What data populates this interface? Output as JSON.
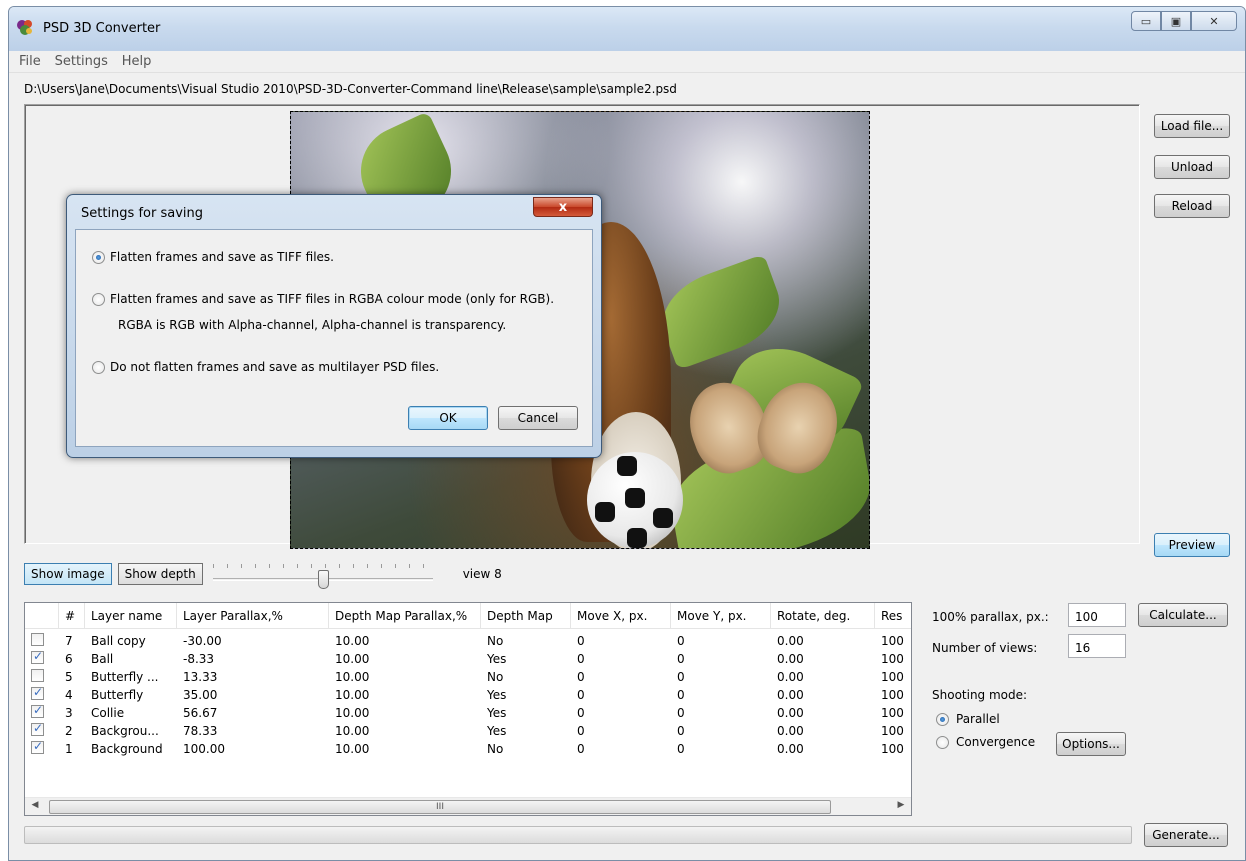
{
  "window": {
    "title": "PSD 3D Converter",
    "minimize_glyph": "▭",
    "maximize_glyph": "▣",
    "close_glyph": "✕"
  },
  "menu": [
    "File",
    "Settings",
    "Help"
  ],
  "file_path": "D:\\Users\\Jane\\Documents\\Visual Studio 2010\\PSD-3D-Converter-Command line\\Release\\sample\\sample2.psd",
  "side_buttons": {
    "load": "Load file...",
    "unload": "Unload",
    "reload": "Reload",
    "preview": "Preview"
  },
  "view_toggle": {
    "show_image": "Show image",
    "show_depth": "Show depth",
    "view_label": "view 8",
    "slider_value": 8,
    "slider_max": 16,
    "active": "Show image"
  },
  "table": {
    "columns": [
      "",
      "#",
      "Layer name",
      "Layer Parallax,%",
      "Depth Map Parallax,%",
      "Depth Map",
      "Move X, px.",
      "Move Y, px.",
      "Rotate, deg.",
      "Res"
    ],
    "rows": [
      {
        "checked": false,
        "num": "7",
        "name": "Ball copy",
        "parallax": "-30.00",
        "dm_parallax": "10.00",
        "depth_map": "No",
        "move_x": "0",
        "move_y": "0",
        "rotate": "0.00",
        "res": "100"
      },
      {
        "checked": true,
        "num": "6",
        "name": "Ball",
        "parallax": "-8.33",
        "dm_parallax": "10.00",
        "depth_map": "Yes",
        "move_x": "0",
        "move_y": "0",
        "rotate": "0.00",
        "res": "100"
      },
      {
        "checked": false,
        "num": "5",
        "name": "Butterfly ...",
        "parallax": "13.33",
        "dm_parallax": "10.00",
        "depth_map": "No",
        "move_x": "0",
        "move_y": "0",
        "rotate": "0.00",
        "res": "100"
      },
      {
        "checked": true,
        "num": "4",
        "name": "Butterfly",
        "parallax": "35.00",
        "dm_parallax": "10.00",
        "depth_map": "Yes",
        "move_x": "0",
        "move_y": "0",
        "rotate": "0.00",
        "res": "100"
      },
      {
        "checked": true,
        "num": "3",
        "name": "Collie",
        "parallax": "56.67",
        "dm_parallax": "10.00",
        "depth_map": "Yes",
        "move_x": "0",
        "move_y": "0",
        "rotate": "0.00",
        "res": "100"
      },
      {
        "checked": true,
        "num": "2",
        "name": "Backgrou...",
        "parallax": "78.33",
        "dm_parallax": "10.00",
        "depth_map": "Yes",
        "move_x": "0",
        "move_y": "0",
        "rotate": "0.00",
        "res": "100"
      },
      {
        "checked": true,
        "num": "1",
        "name": "Background",
        "parallax": "100.00",
        "dm_parallax": "10.00",
        "depth_map": "No",
        "move_x": "0",
        "move_y": "0",
        "rotate": "0.00",
        "res": "100"
      }
    ],
    "scroll_grip": "III"
  },
  "params": {
    "parallax_label": "100% parallax, px.:",
    "parallax_value": "100",
    "calculate": "Calculate...",
    "views_label": "Number of views:",
    "views_value": "16",
    "shooting_label": "Shooting mode:",
    "parallel": "Parallel",
    "convergence": "Convergence",
    "options": "Options...",
    "selected_mode": "Parallel"
  },
  "generate": "Generate...",
  "progress": 0,
  "dialog": {
    "title": "Settings for saving",
    "close": "x",
    "option1": "Flatten frames and save as TIFF files.",
    "option2": "Flatten frames and save as TIFF files in  RGBA colour mode (only for RGB).",
    "option2_note": "RGBA is RGB with Alpha-channel, Alpha-channel is transparency.",
    "option3": "Do not flatten frames and save as multilayer PSD files.",
    "selected_option": 1,
    "ok": "OK",
    "cancel": "Cancel"
  },
  "colors": {
    "title_bar": "#c9daee",
    "window_bg": "#f0f0f0",
    "accent_button": "#3c7fb1",
    "close_button": "#c9482a"
  }
}
